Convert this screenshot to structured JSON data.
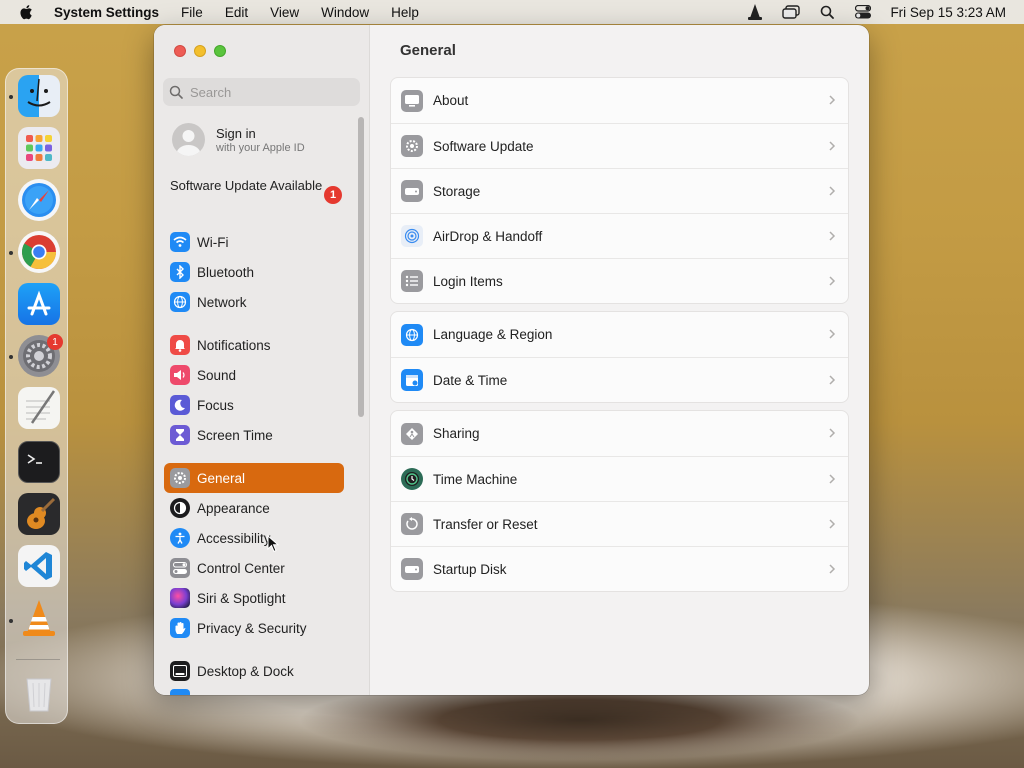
{
  "menubar": {
    "app_name": "System Settings",
    "menus": [
      "File",
      "Edit",
      "View",
      "Window",
      "Help"
    ],
    "clock": "Fri Sep 15  3:23 AM",
    "status_icons": [
      "vlc-icon",
      "screen-mirroring-icon",
      "spotlight-search-icon",
      "control-center-icon"
    ]
  },
  "dock": {
    "apps": [
      "finder",
      "launchpad",
      "safari",
      "chrome",
      "app-store",
      "system-settings",
      "textedit",
      "terminal",
      "garageband",
      "vscode",
      "vlc",
      "trash"
    ],
    "settings_badge": "1"
  },
  "sidebar": {
    "search_placeholder": "Search",
    "signin_title": "Sign in",
    "signin_subtitle": "with your Apple ID",
    "update_label": "Software Update Available",
    "update_badge": "1",
    "items": [
      {
        "label": "Wi-Fi",
        "icon": "wifi-icon",
        "color": "#1f8af5"
      },
      {
        "label": "Bluetooth",
        "icon": "bluetooth-icon",
        "color": "#1f8af5"
      },
      {
        "label": "Network",
        "icon": "globe-icon",
        "color": "#1f8af5"
      },
      {
        "label": "Notifications",
        "icon": "bell-icon",
        "color": "#ef4b46"
      },
      {
        "label": "Sound",
        "icon": "speaker-icon",
        "color": "#ee4a6b"
      },
      {
        "label": "Focus",
        "icon": "moon-icon",
        "color": "#5b5bd6"
      },
      {
        "label": "Screen Time",
        "icon": "hourglass-icon",
        "color": "#6c5bd4"
      },
      {
        "label": "General",
        "icon": "gear-icon",
        "color": "#9a9a9e"
      },
      {
        "label": "Appearance",
        "icon": "appearance-icon",
        "color": "#1c1c1e"
      },
      {
        "label": "Accessibility",
        "icon": "accessibility-icon",
        "color": "#1f8af5"
      },
      {
        "label": "Control Center",
        "icon": "control-center-icon",
        "color": "#8e8e93"
      },
      {
        "label": "Siri & Spotlight",
        "icon": "siri-icon",
        "color": "#7a3fd1"
      },
      {
        "label": "Privacy & Security",
        "icon": "hand-icon",
        "color": "#1f8af5"
      },
      {
        "label": "Desktop & Dock",
        "icon": "dock-icon",
        "color": "#1c1c1e"
      }
    ],
    "selected": "General"
  },
  "content": {
    "title": "General",
    "groups": [
      [
        {
          "label": "About",
          "icon": "about-icon"
        },
        {
          "label": "Software Update",
          "icon": "software-update-icon"
        },
        {
          "label": "Storage",
          "icon": "storage-icon"
        },
        {
          "label": "AirDrop & Handoff",
          "icon": "airdrop-icon"
        },
        {
          "label": "Login Items",
          "icon": "login-items-icon"
        }
      ],
      [
        {
          "label": "Language & Region",
          "icon": "language-globe-icon"
        },
        {
          "label": "Date & Time",
          "icon": "calendar-icon"
        }
      ],
      [
        {
          "label": "Sharing",
          "icon": "sharing-icon"
        },
        {
          "label": "Time Machine",
          "icon": "time-machine-icon"
        },
        {
          "label": "Transfer or Reset",
          "icon": "transfer-reset-icon"
        },
        {
          "label": "Startup Disk",
          "icon": "startup-disk-icon"
        }
      ]
    ]
  },
  "colors": {
    "accent": "#d8690f",
    "badge": "#e5392f"
  }
}
